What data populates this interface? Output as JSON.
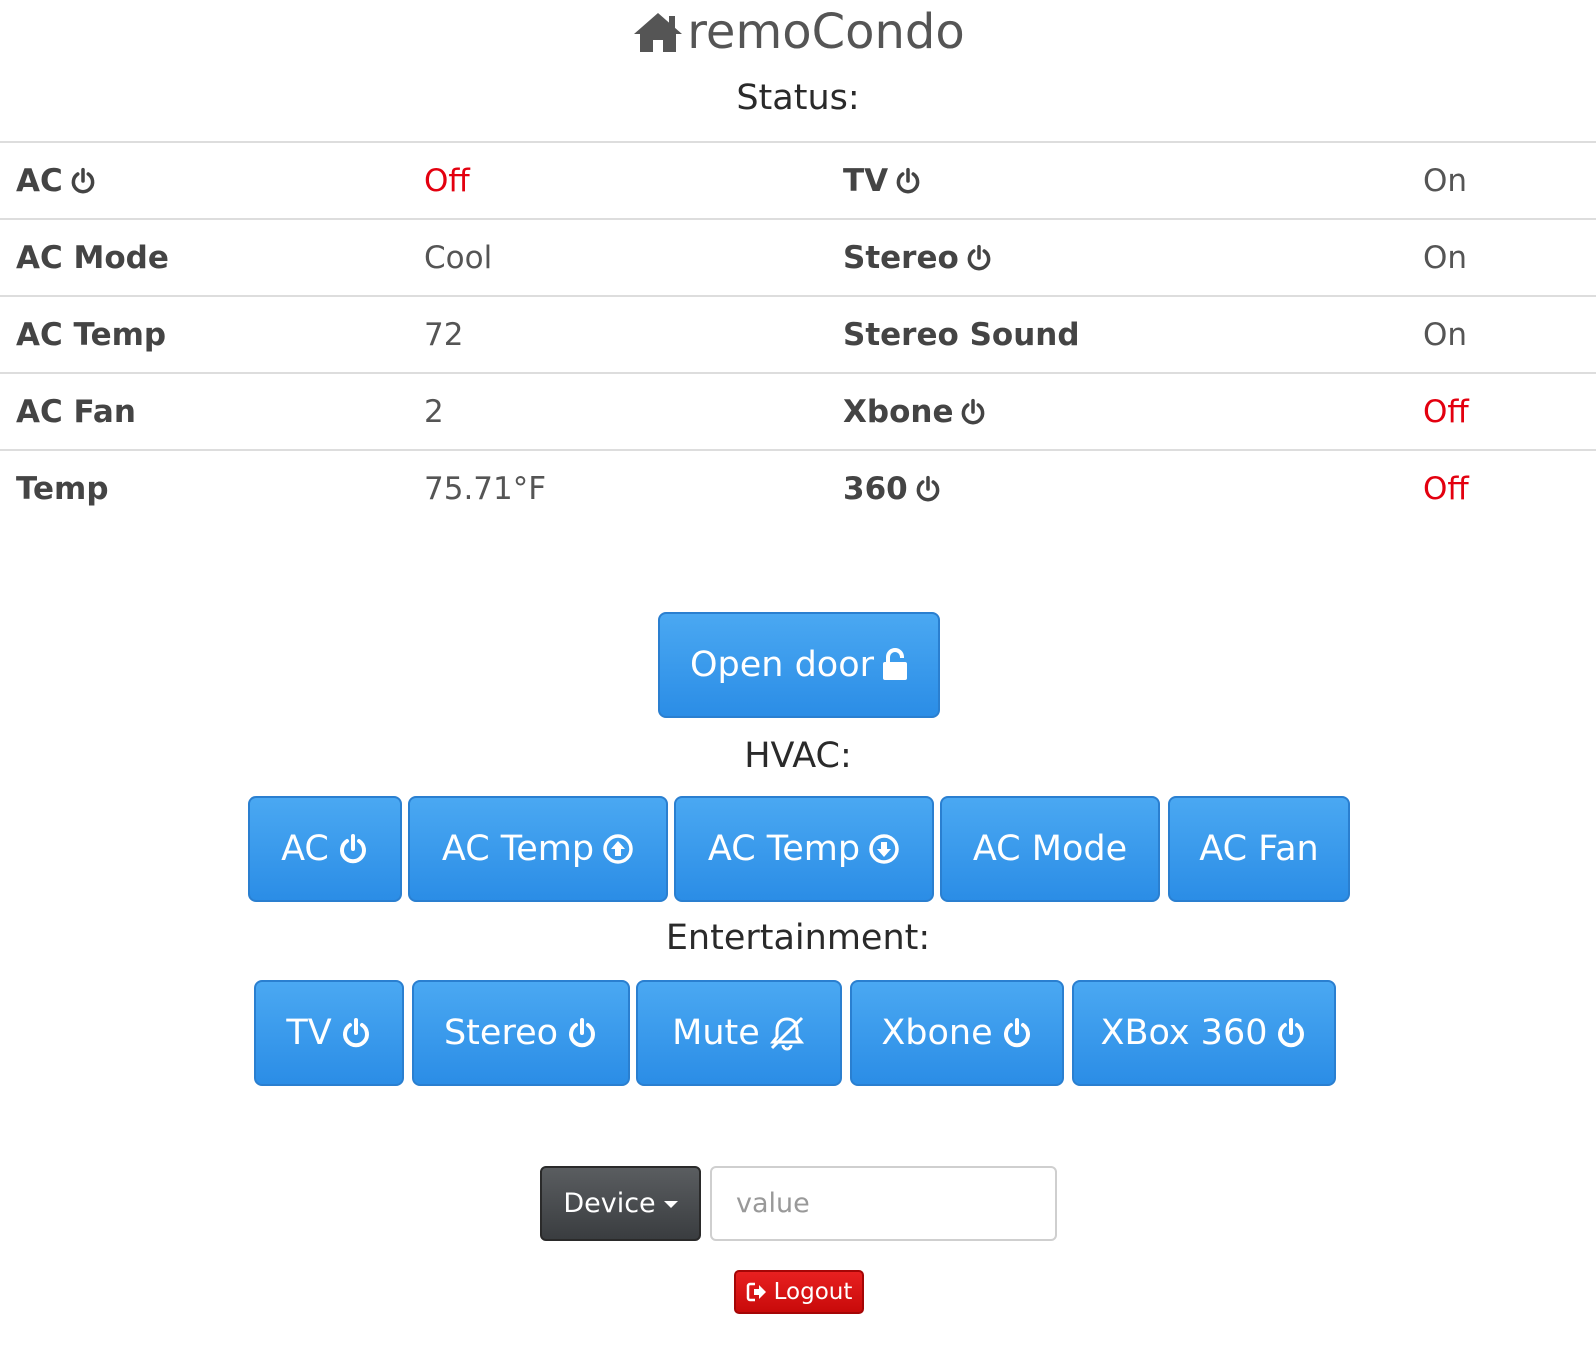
{
  "header": {
    "title": "remoCondo"
  },
  "status": {
    "title": "Status:",
    "rows": [
      {
        "left_label": "AC",
        "left_power": true,
        "left_value": "Off",
        "left_off": true,
        "right_label": "TV",
        "right_power": true,
        "right_value": "On",
        "right_off": false
      },
      {
        "left_label": "AC Mode",
        "left_power": false,
        "left_value": "Cool",
        "left_off": false,
        "right_label": "Stereo",
        "right_power": true,
        "right_value": "On",
        "right_off": false
      },
      {
        "left_label": "AC Temp",
        "left_power": false,
        "left_value": "72",
        "left_off": false,
        "right_label": "Stereo Sound",
        "right_power": false,
        "right_value": "On",
        "right_off": false
      },
      {
        "left_label": "AC Fan",
        "left_power": false,
        "left_value": "2",
        "left_off": false,
        "right_label": "Xbone",
        "right_power": true,
        "right_value": "Off",
        "right_off": true
      },
      {
        "left_label": "Temp",
        "left_power": false,
        "left_value": "75.71°F",
        "left_off": false,
        "right_label": "360",
        "right_power": true,
        "right_value": "Off",
        "right_off": true
      }
    ]
  },
  "door": {
    "label": "Open door",
    "icon": "unlock-icon"
  },
  "hvac": {
    "title": "HVAC:",
    "buttons": [
      {
        "label": "AC",
        "icon": "power-icon"
      },
      {
        "label": "AC Temp",
        "icon": "arrow-up-circle-icon"
      },
      {
        "label": "AC Temp",
        "icon": "arrow-down-circle-icon"
      },
      {
        "label": "AC Mode",
        "icon": ""
      },
      {
        "label": "AC Fan",
        "icon": ""
      }
    ]
  },
  "entertainment": {
    "title": "Entertainment:",
    "buttons": [
      {
        "label": "TV",
        "icon": "power-icon"
      },
      {
        "label": "Stereo",
        "icon": "power-icon"
      },
      {
        "label": "Mute",
        "icon": "bell-slash-icon"
      },
      {
        "label": "Xbone",
        "icon": "power-icon"
      },
      {
        "label": "XBox 360",
        "icon": "power-icon"
      }
    ]
  },
  "controls": {
    "device_label": "Device",
    "value_placeholder": "value",
    "value": ""
  },
  "logout": {
    "label": "Logout",
    "icon": "sign-out-icon"
  },
  "colors": {
    "primary": "#2b8de6",
    "danger": "#e3000f",
    "dark": "#3a3d40"
  }
}
